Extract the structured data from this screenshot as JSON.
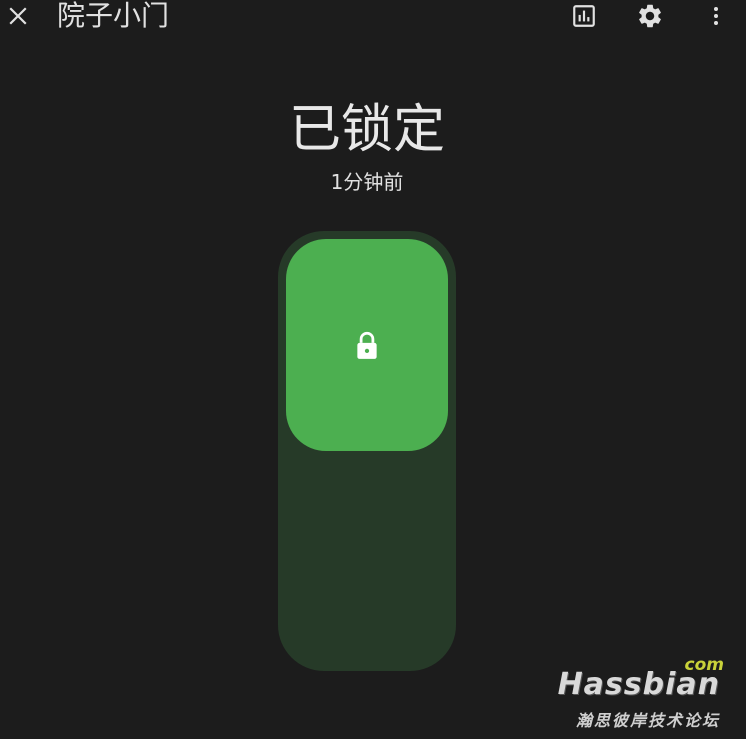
{
  "header": {
    "title": "院子小门",
    "close_icon": "close-icon",
    "history_icon": "history-chart-icon",
    "settings_icon": "gear-icon",
    "more_icon": "more-vertical-icon"
  },
  "lock": {
    "state": "已锁定",
    "last_changed": "1分钟前",
    "icon": "lock-icon",
    "thumb_color": "#4caf50",
    "track_color": "#263a28"
  },
  "watermark": {
    "com": "com",
    "brand": "Hassbian",
    "subtitle": "瀚思彼岸技术论坛"
  }
}
